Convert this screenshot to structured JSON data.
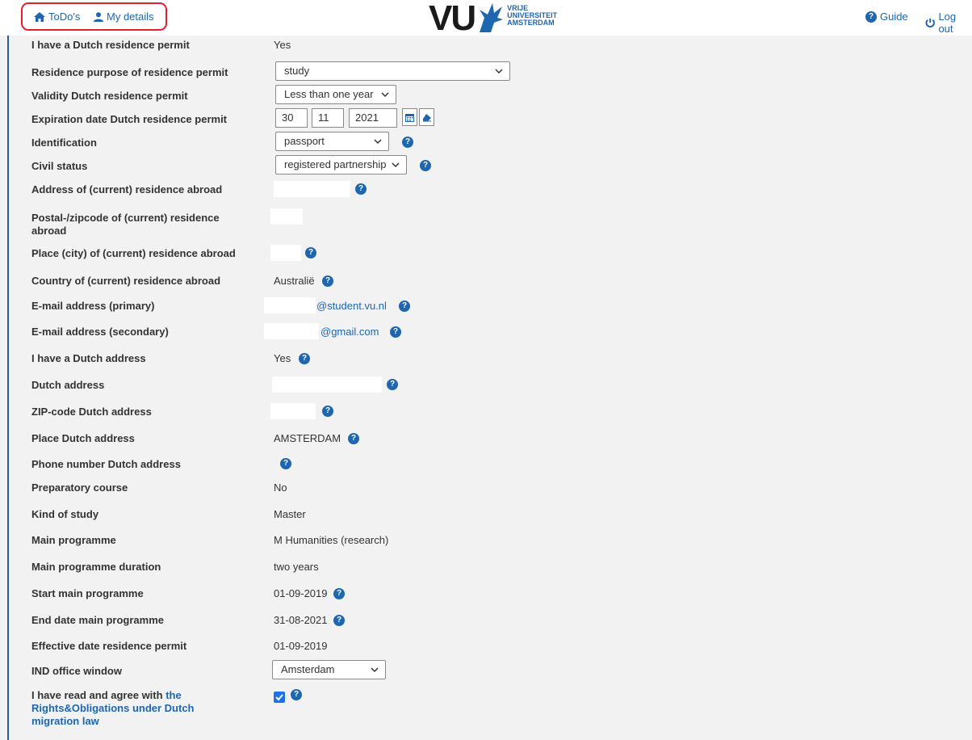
{
  "nav": {
    "todos": "ToDo's",
    "my_details": "My details",
    "guide": "Guide",
    "logout": "Log out"
  },
  "logo": {
    "mark": "VU",
    "line1": "VRIJE",
    "line2": "UNIVERSITEIT",
    "line3": "AMSTERDAM"
  },
  "form": {
    "dutch_permit_label": "I have a Dutch residence permit",
    "dutch_permit_value": "Yes",
    "purpose_label": "Residence purpose of residence permit",
    "purpose_value": "study",
    "validity_label": "Validity Dutch residence permit",
    "validity_value": "Less than one year",
    "expiration_label": "Expiration date Dutch residence permit",
    "exp_day": "30",
    "exp_month": "11",
    "exp_year": "2021",
    "identification_label": "Identification",
    "identification_value": "passport",
    "civil_label": "Civil status",
    "civil_value": "registered partnership",
    "address_abroad_label": "Address of (current) residence abroad",
    "postal_abroad_label": "Postal-/zipcode of (current) residence abroad",
    "place_abroad_label": "Place (city) of (current) residence abroad",
    "country_abroad_label": "Country of (current) residence abroad",
    "country_abroad_value": "Australië",
    "email_primary_label": "E-mail address (primary)",
    "email_primary_value": "@student.vu.nl",
    "email_secondary_label": "E-mail address (secondary)",
    "email_secondary_value": "@gmail.com",
    "dutch_address_q_label": "I have a Dutch address",
    "dutch_address_q_value": "Yes",
    "dutch_address_label": "Dutch address",
    "zip_dutch_label": "ZIP-code Dutch address",
    "place_dutch_label": "Place Dutch address",
    "place_dutch_value": "AMSTERDAM",
    "phone_dutch_label": "Phone number Dutch address",
    "prep_label": "Preparatory course",
    "prep_value": "No",
    "kind_label": "Kind of study",
    "kind_value": "Master",
    "main_prog_label": "Main programme",
    "main_prog_value": "M Humanities (research)",
    "duration_label": "Main programme duration",
    "duration_value": "two years",
    "start_label": "Start main programme",
    "start_value": "01-09-2019",
    "end_label": "End date main programme",
    "end_value": "31-08-2021",
    "effective_label": "Effective date residence permit",
    "effective_value": "01-09-2019",
    "ind_label": "IND office window",
    "ind_value": "Amsterdam",
    "agree_prefix": "I have read and agree with",
    "agree_link": "the Rights&Obligations under Dutch migration law",
    "agree_checked": true
  },
  "colors": {
    "accent": "#1e66b0",
    "background": "#f2f2f2",
    "highlight": "#e02030"
  }
}
